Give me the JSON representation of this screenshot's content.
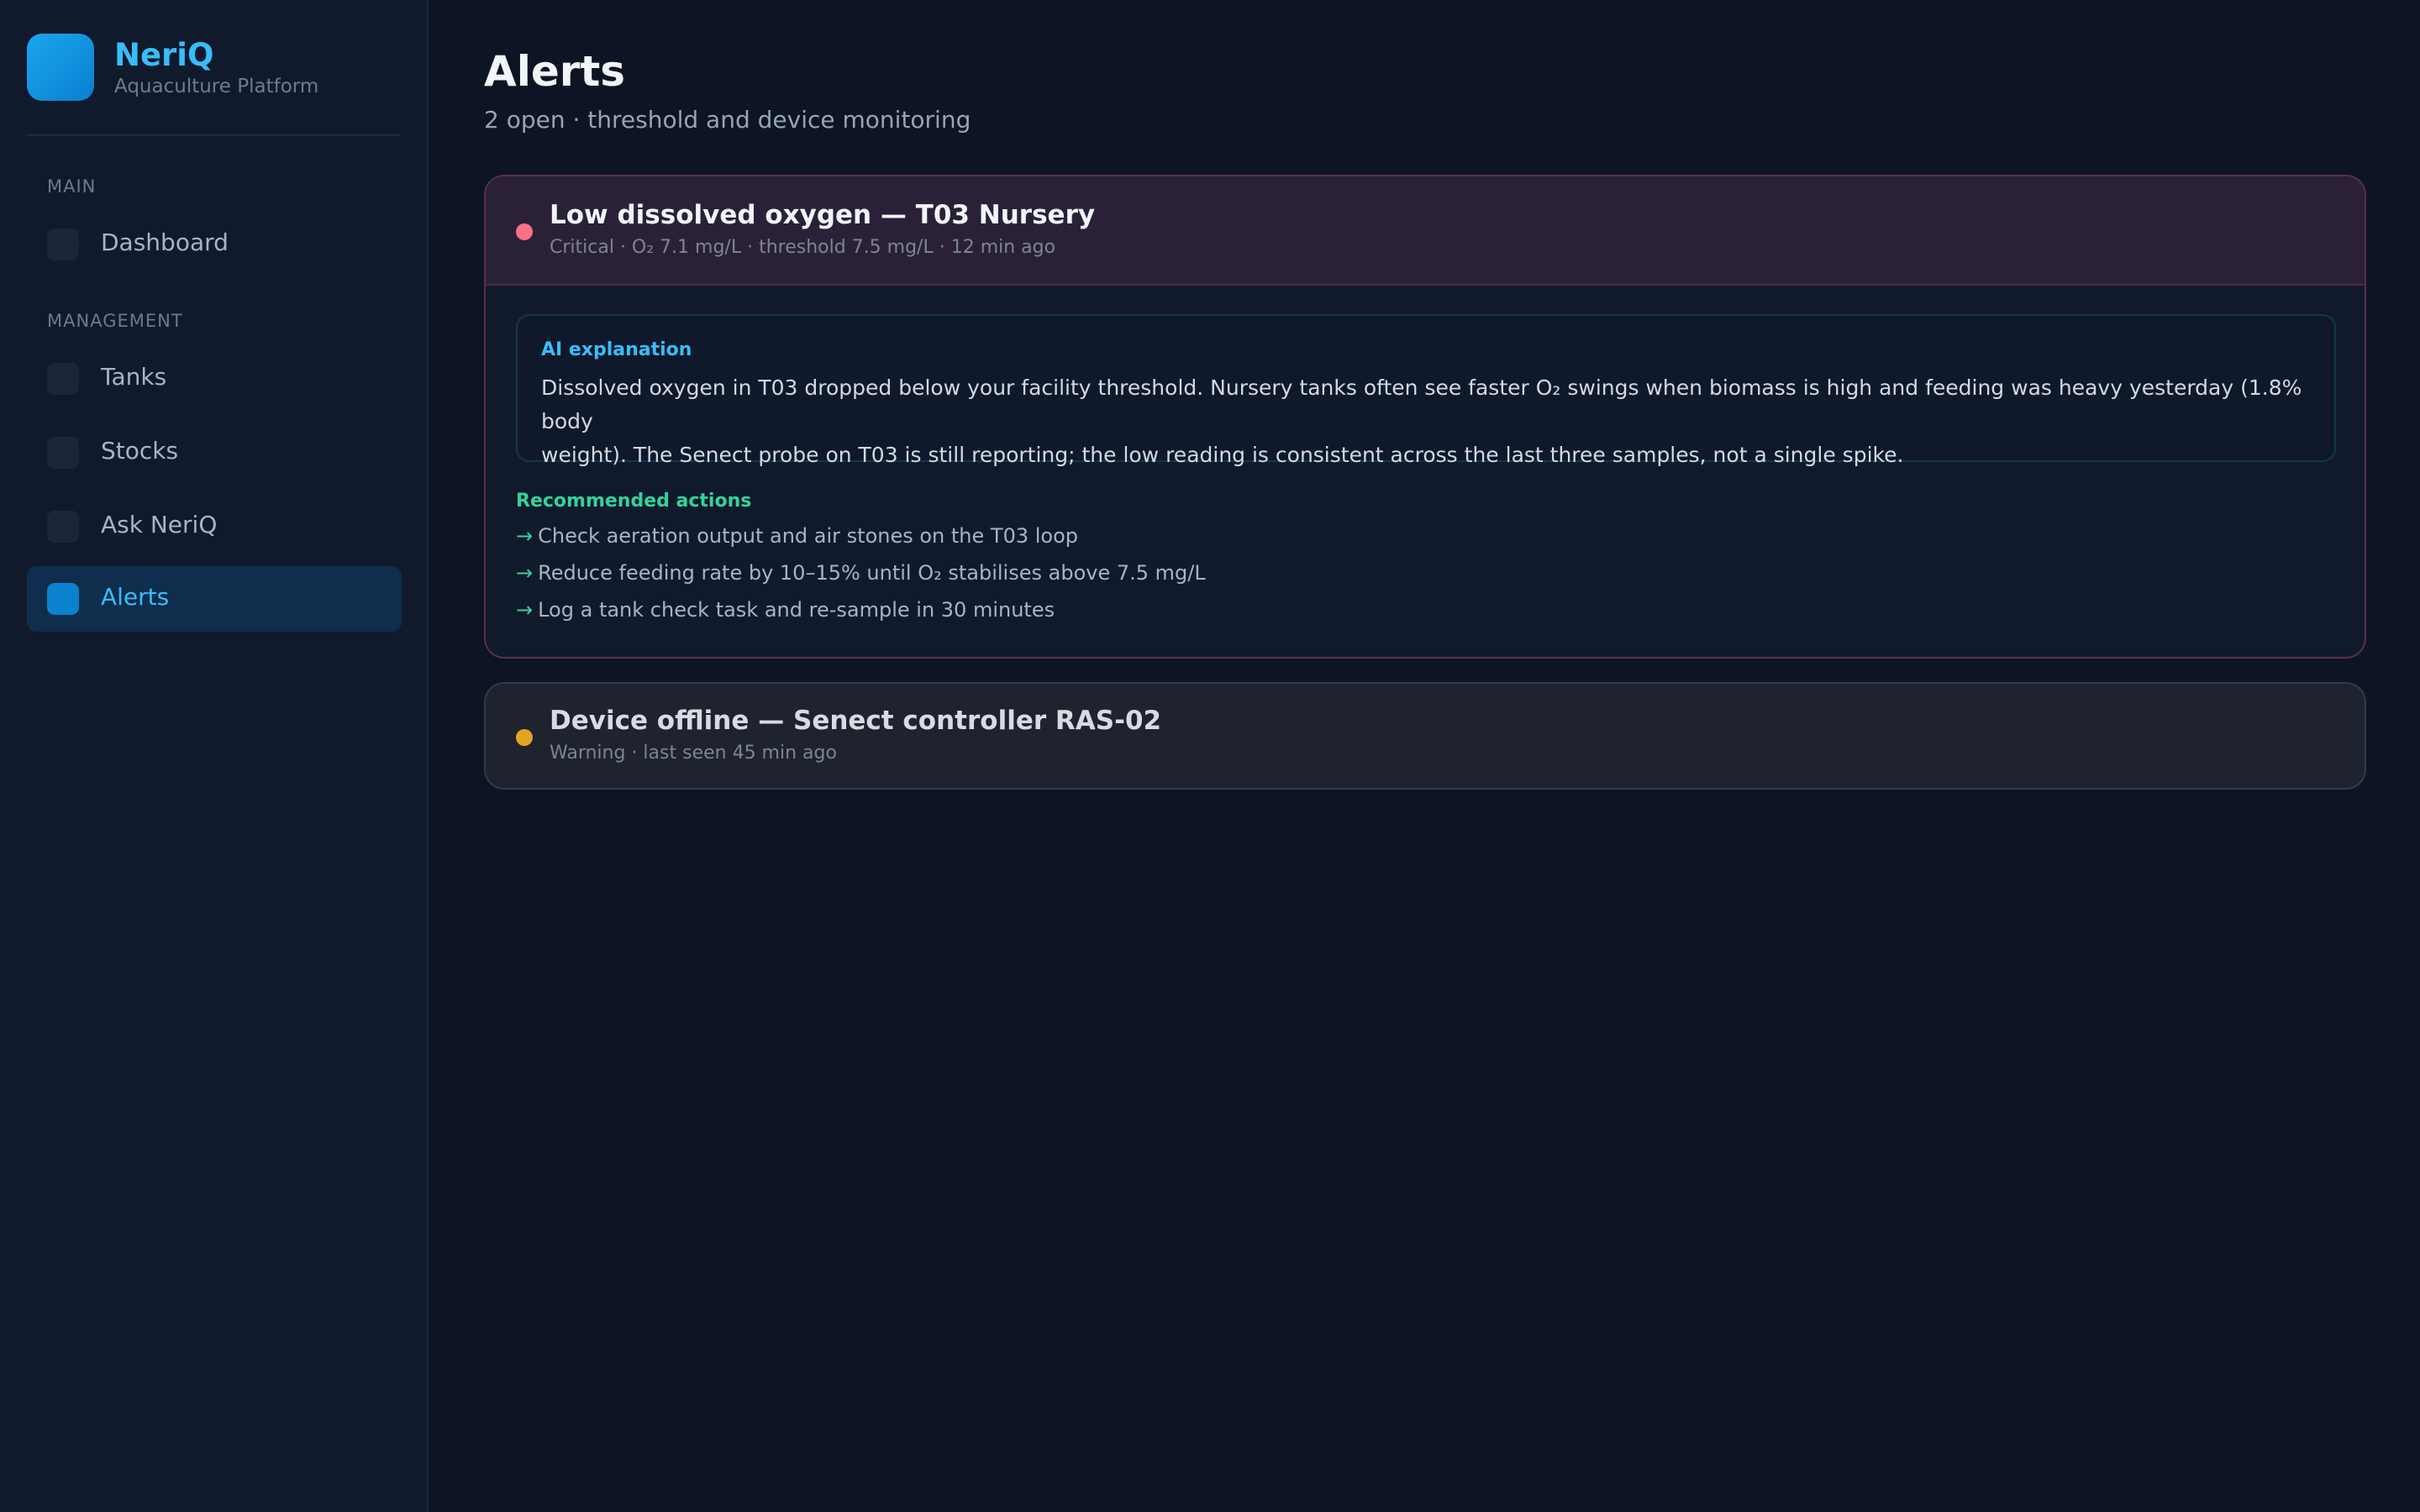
{
  "brand": {
    "name": "NeriQ",
    "subtitle": "Aquaculture Platform"
  },
  "sidebar": {
    "sections": [
      {
        "label": "MAIN"
      },
      {
        "label": "MANAGEMENT"
      }
    ],
    "items": [
      {
        "label": "Dashboard",
        "icon": "dashboard-icon",
        "active": false
      },
      {
        "label": "Tanks",
        "icon": "tanks-icon",
        "active": false
      },
      {
        "label": "Stocks",
        "icon": "stocks-icon",
        "active": false
      },
      {
        "label": "Ask NeriQ",
        "icon": "ask-icon",
        "active": false
      },
      {
        "label": "Alerts",
        "icon": "alerts-icon",
        "active": true
      }
    ]
  },
  "page": {
    "title": "Alerts",
    "subtitle": "2 open · threshold and device monitoring"
  },
  "alerts": [
    {
      "severity": "critical",
      "status_color": "#fb7185",
      "title": "Low dissolved oxygen — T03 Nursery",
      "meta": "Critical · O₂ 7.1 mg/L · threshold 7.5 mg/L · 12 min ago",
      "ai_label": "AI explanation",
      "ai_text_line1": "Dissolved oxygen in T03 dropped below your facility threshold. Nursery tanks often see faster O₂ swings when biomass is high and feeding was heavy yesterday (1.8% body",
      "ai_text_line2": "weight). The Senect probe on T03 is still reporting; the low reading is consistent across the last three samples, not a single spike.",
      "actions_label": "Recommended actions",
      "action_arrow": "→",
      "actions": [
        "Check aeration output and air stones on the T03 loop",
        "Reduce feeding rate by 10–15% until O₂ stabilises above 7.5 mg/L",
        "Log a tank check task and re-sample in 30 minutes"
      ]
    },
    {
      "severity": "warning",
      "status_color": "#e2a526",
      "title": "Device offline — Senect controller RAS-02",
      "meta": "Warning · last seen 45 min ago"
    }
  ],
  "colors": {
    "accent": "#38bdf8",
    "background": "#0d1424",
    "sidebar": "#111a2c",
    "success": "#34d399"
  }
}
